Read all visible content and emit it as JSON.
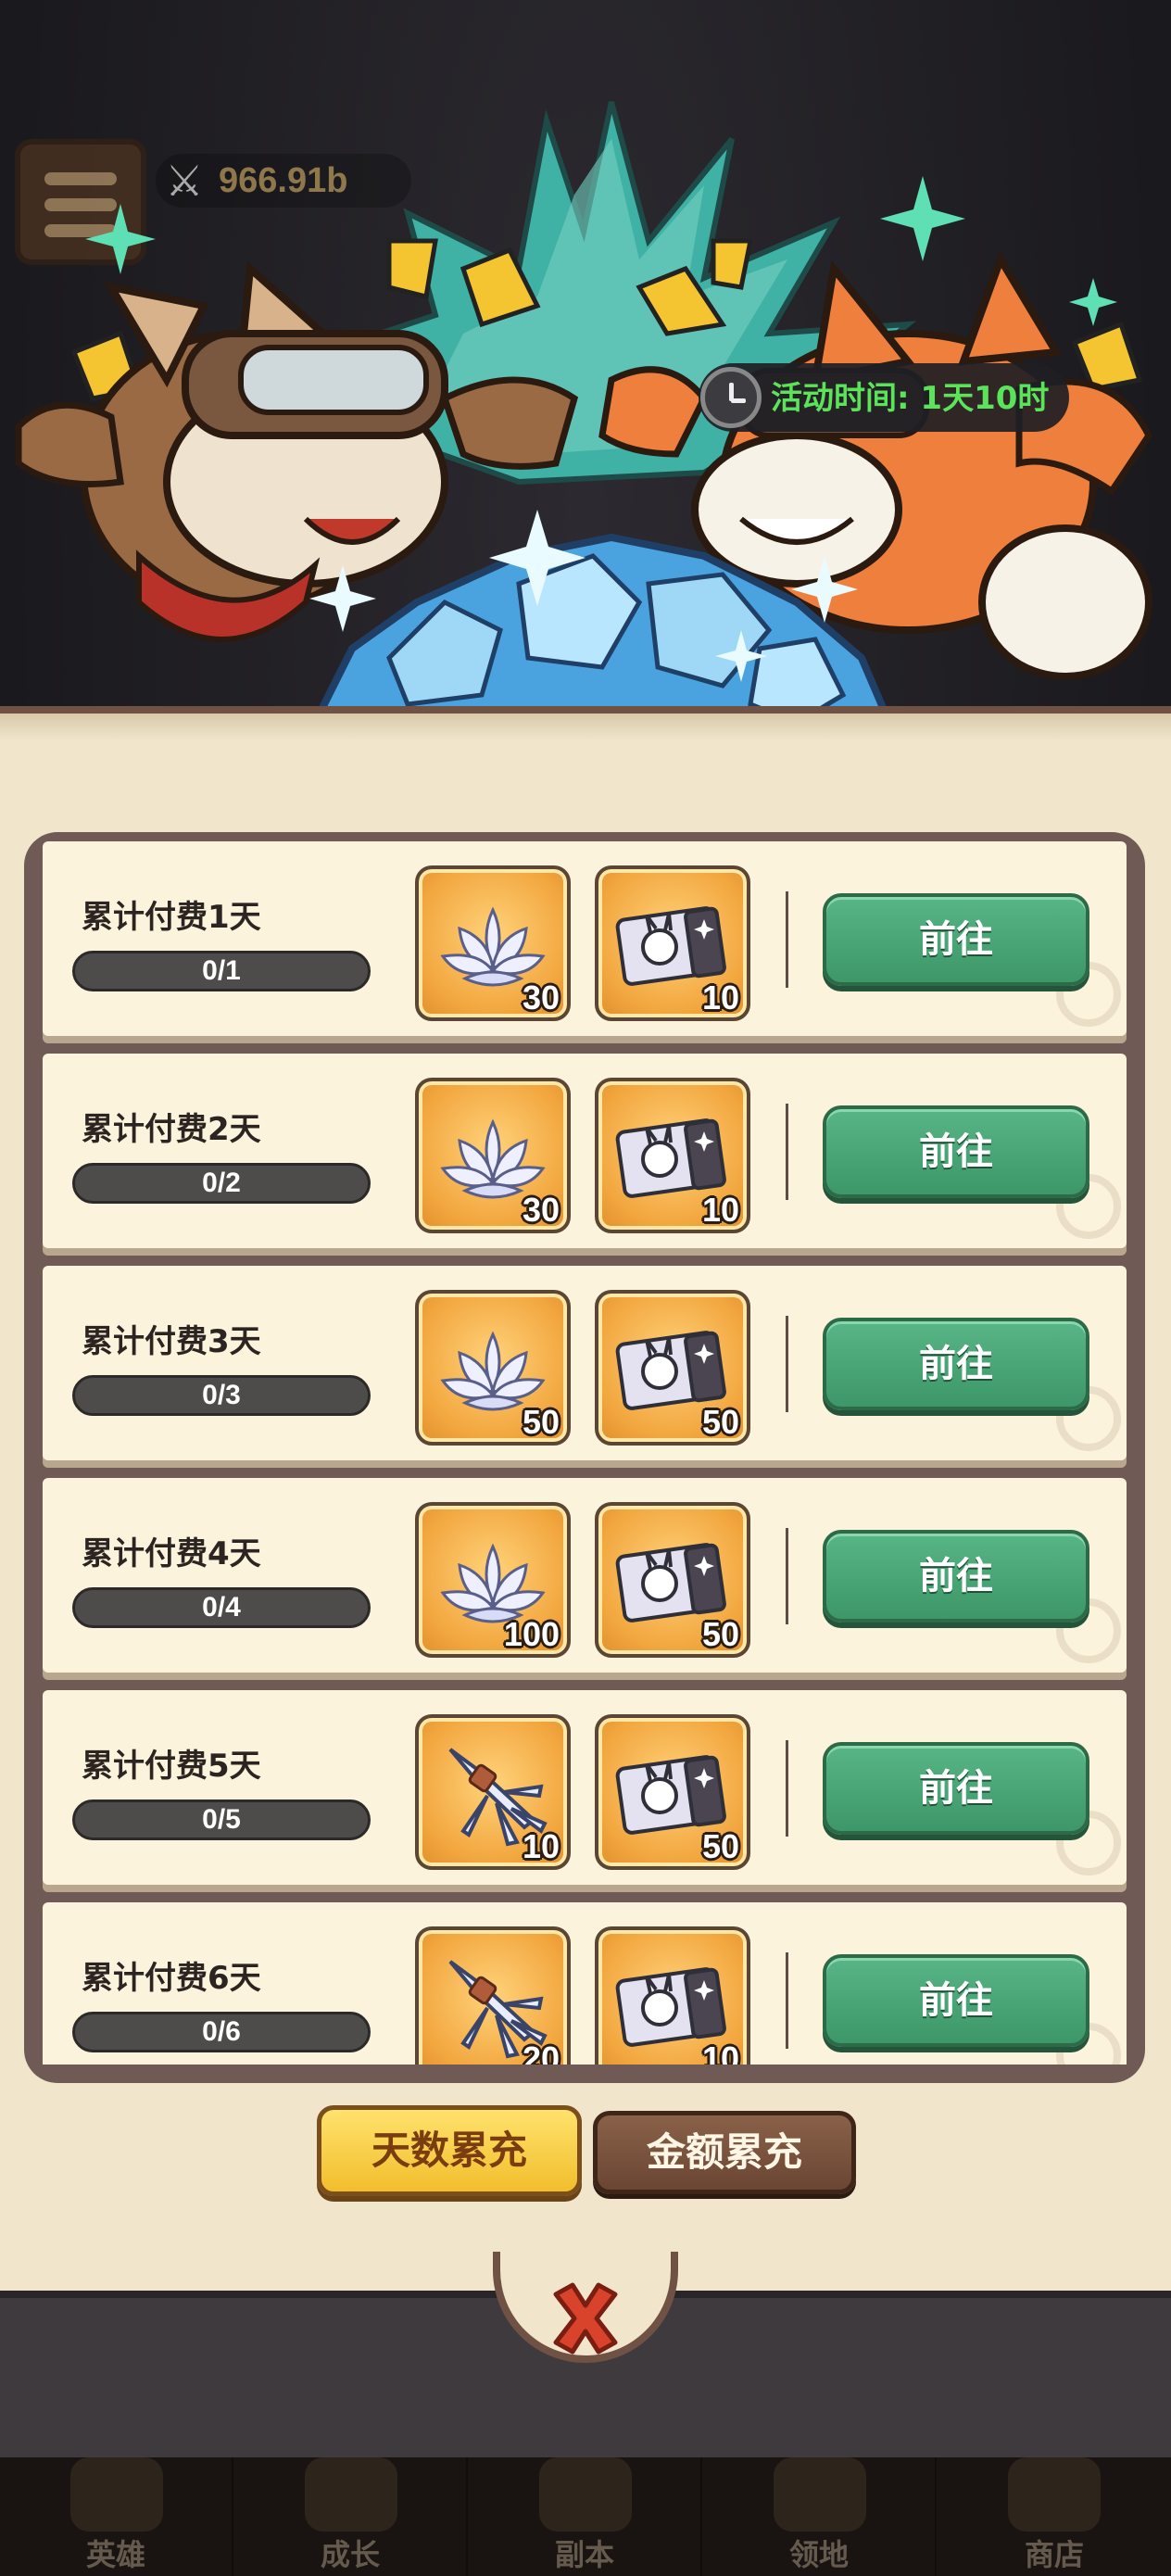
{
  "background": {
    "power_value": "966.91b"
  },
  "banner": {
    "timer_text": "活动时间: 1天10时"
  },
  "rows": [
    {
      "title": "累计付费1天",
      "progress": "0/1",
      "progress_fraction": 0,
      "rewards": [
        {
          "icon": "lotus-flower-icon",
          "qty": "30"
        },
        {
          "icon": "rabbit-ticket-icon",
          "qty": "10"
        }
      ],
      "button": "前往"
    },
    {
      "title": "累计付费2天",
      "progress": "0/2",
      "progress_fraction": 0,
      "rewards": [
        {
          "icon": "lotus-flower-icon",
          "qty": "30"
        },
        {
          "icon": "rabbit-ticket-icon",
          "qty": "10"
        }
      ],
      "button": "前往"
    },
    {
      "title": "累计付费3天",
      "progress": "0/3",
      "progress_fraction": 0,
      "rewards": [
        {
          "icon": "lotus-flower-icon",
          "qty": "50"
        },
        {
          "icon": "rabbit-ticket-icon",
          "qty": "50"
        }
      ],
      "button": "前往"
    },
    {
      "title": "累计付费4天",
      "progress": "0/4",
      "progress_fraction": 0,
      "rewards": [
        {
          "icon": "lotus-flower-icon",
          "qty": "100"
        },
        {
          "icon": "rabbit-ticket-icon",
          "qty": "50"
        }
      ],
      "button": "前往"
    },
    {
      "title": "累计付费5天",
      "progress": "0/5",
      "progress_fraction": 0,
      "rewards": [
        {
          "icon": "crystal-branch-icon",
          "qty": "10"
        },
        {
          "icon": "rabbit-ticket-icon",
          "qty": "50"
        }
      ],
      "button": "前往"
    },
    {
      "title": "累计付费6天",
      "progress": "0/6",
      "progress_fraction": 0,
      "rewards": [
        {
          "icon": "crystal-branch-icon",
          "qty": "20"
        },
        {
          "icon": "rabbit-ticket-icon",
          "qty": "10"
        }
      ],
      "button": "前往"
    }
  ],
  "tabs": {
    "days": "天数累充",
    "amount": "金额累充",
    "active": "days"
  },
  "nav": [
    {
      "label": "英雄"
    },
    {
      "label": "成长"
    },
    {
      "label": "副本"
    },
    {
      "label": "领地"
    },
    {
      "label": "商店"
    }
  ],
  "colors": {
    "timer_green": "#5be35a",
    "go_button": "#4aa676",
    "active_tab": "#f2be2c",
    "inactive_tab": "#6a4633",
    "close_red": "#d9432b"
  }
}
